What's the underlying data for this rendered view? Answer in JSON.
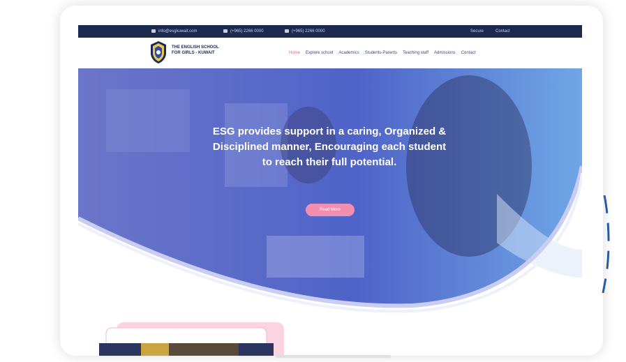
{
  "topbar": {
    "email": "info@esgkuwait.com",
    "phone1": "(+965) 2266 0000",
    "phone2": "(+965) 2266 0000",
    "link1": "Secure",
    "link2": "Contact"
  },
  "header": {
    "school_line1": "THE ENGLISH SCHOOL",
    "school_line2": "FOR GIRLS - KUWAIT",
    "nav": [
      "Home",
      "Explore school",
      "Academics",
      "Students-Parents",
      "Teaching staff",
      "Admissions",
      "Contact"
    ]
  },
  "hero": {
    "line1": "ESG provides support in a caring, Organized &",
    "line2": "Disciplined manner, Encouraging each student",
    "line3": "to reach their full potential.",
    "button": "Read More"
  },
  "colors": {
    "navy": "#1d2a4f",
    "pink": "#f28fb0",
    "accent": "#e8628a",
    "overlay": "#4f63c8"
  }
}
